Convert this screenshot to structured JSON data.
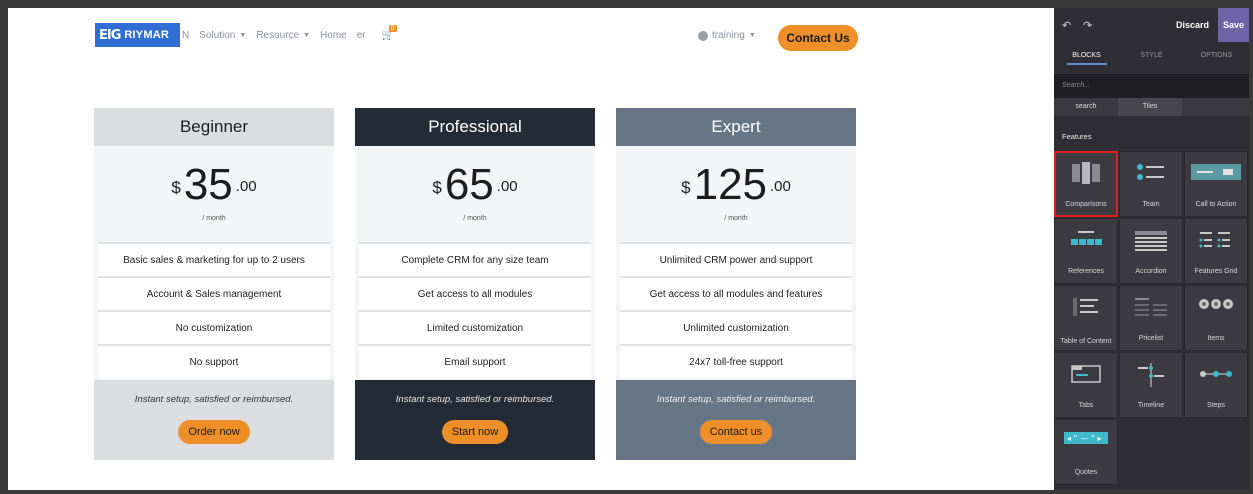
{
  "website": {
    "logo": {
      "mark": "EIG",
      "text": "RIYMAR"
    },
    "nav": {
      "items": [
        {
          "label": "N",
          "has_caret": false
        },
        {
          "label": "Solution",
          "has_caret": true
        },
        {
          "label": "Resource",
          "has_caret": true
        },
        {
          "label": "Home",
          "has_caret": false
        },
        {
          "label": "er",
          "has_caret": false
        }
      ],
      "cart_count": "0",
      "user_label": "training",
      "contact_label": "Contact Us"
    },
    "plans": [
      {
        "name": "Beginner",
        "currency": "$",
        "amount": "35",
        "cents": ".00",
        "period": "/ month",
        "features": [
          "Basic sales & marketing for up to 2 users",
          "Account & Sales management",
          "No customization",
          "No support"
        ],
        "footer_text": "Instant setup, satisfied or reimbursed.",
        "button_label": "Order now"
      },
      {
        "name": "Professional",
        "currency": "$",
        "amount": "65",
        "cents": ".00",
        "period": "/ month",
        "features": [
          "Complete CRM for any size team",
          "Get access to all modules",
          "Limited customization",
          "Email support"
        ],
        "footer_text": "Instant setup, satisfied or reimbursed.",
        "button_label": "Start now"
      },
      {
        "name": "Expert",
        "currency": "$",
        "amount": "125",
        "cents": ".00",
        "period": "/ month",
        "features": [
          "Unlimited CRM power and support",
          "Get access to all modules and features",
          "Unlimited customization",
          "24x7 toll-free support"
        ],
        "footer_text": "Instant setup, satisfied or reimbursed.",
        "button_label": "Contact us"
      }
    ]
  },
  "editor": {
    "undo_icon": "undo-icon",
    "redo_icon": "redo-icon",
    "discard_label": "Discard",
    "save_label": "Save",
    "tabs": [
      {
        "label": "BLOCKS",
        "active": true
      },
      {
        "label": "STYLE",
        "active": false
      },
      {
        "label": "OPTIONS",
        "active": false
      }
    ],
    "search_placeholder": "Search...",
    "chips": [
      "search",
      "Tiles"
    ],
    "section_title": "Features",
    "blocks": [
      {
        "label": "Comparisons",
        "selected": true
      },
      {
        "label": "Team",
        "selected": false
      },
      {
        "label": "Call to Action",
        "selected": false
      },
      {
        "label": "References",
        "selected": false
      },
      {
        "label": "Accordion",
        "selected": false
      },
      {
        "label": "Features Grid",
        "selected": false
      },
      {
        "label": "Table of Content",
        "selected": false
      },
      {
        "label": "Pricelist",
        "selected": false
      },
      {
        "label": "Items",
        "selected": false
      },
      {
        "label": "Tabs",
        "selected": false
      },
      {
        "label": "Timeline",
        "selected": false
      },
      {
        "label": "Steps",
        "selected": false
      },
      {
        "label": "Quotes",
        "selected": false
      }
    ]
  },
  "colors": {
    "accent_orange": "#ef8f2a",
    "pro_dark": "#222b36",
    "expert_slate": "#667686",
    "beginner_gray": "#dcdde1",
    "save_purple": "#6e62a8",
    "selection_red": "#e01e1e"
  }
}
